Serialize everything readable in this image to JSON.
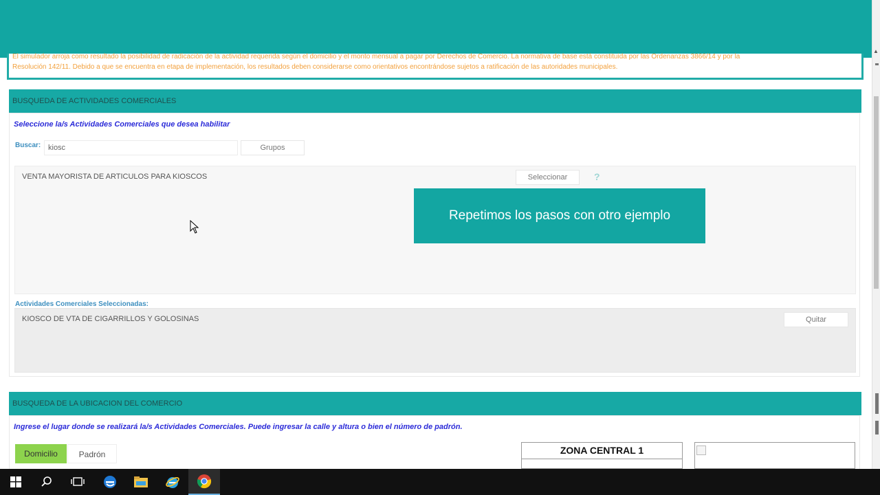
{
  "notice": {
    "line1": "El simulador arroja como resultado la posibilidad de radicación de la actividad requerida según el domicilio y el monto mensual a pagar por Derechos de Comercio. La normativa de base está constituida por las Ordenanzas 3866/14 y por la",
    "line2": "Resolución 142/11. Debido a que se encuentra en etapa de implementación, los resultados deben considerarse como orientativos encontrándose sujetos a ratificación de las autoridades municipales."
  },
  "actividades": {
    "header": "BUSQUEDA DE ACTIVIDADES COMERCIALES",
    "instruction": "Seleccione la/s Actividades Comerciales que desea habilitar",
    "search_label": "Buscar:",
    "search_value": "kiosc",
    "grupos_button": "Grupos",
    "results": [
      {
        "label": "VENTA MAYORISTA DE ARTICULOS PARA KIOSCOS",
        "button": "Seleccionar",
        "help": "?"
      }
    ],
    "selected_label": "Actividades Comerciales Seleccionadas:",
    "selected": [
      {
        "label": "KIOSCO DE VTA DE CIGARRILLOS Y GOLOSINAS",
        "button": "Quitar"
      }
    ]
  },
  "overlay": {
    "text": "Repetimos los pasos con otro ejemplo"
  },
  "ubicacion": {
    "header": "BUSQUEDA DE LA UBICACION DEL COMERCIO",
    "instruction": "Ingrese el lugar donde se realizará la/s Actividades Comerciales. Puede ingresar la calle y altura o bien el número de padrón.",
    "tabs": [
      "Domicilio",
      "Padrón"
    ],
    "zona_title": "ZONA CENTRAL 1"
  },
  "taskbar": {
    "icons": [
      "windows-start-icon",
      "search-icon",
      "task-view-icon",
      "edge-icon",
      "file-explorer-icon",
      "internet-explorer-icon",
      "chrome-icon"
    ]
  },
  "colors": {
    "accent": "#12a6a2",
    "notice_text": "#f2a03c",
    "instruction_text": "#2b2bd8",
    "active_tab": "#8dd34d"
  }
}
